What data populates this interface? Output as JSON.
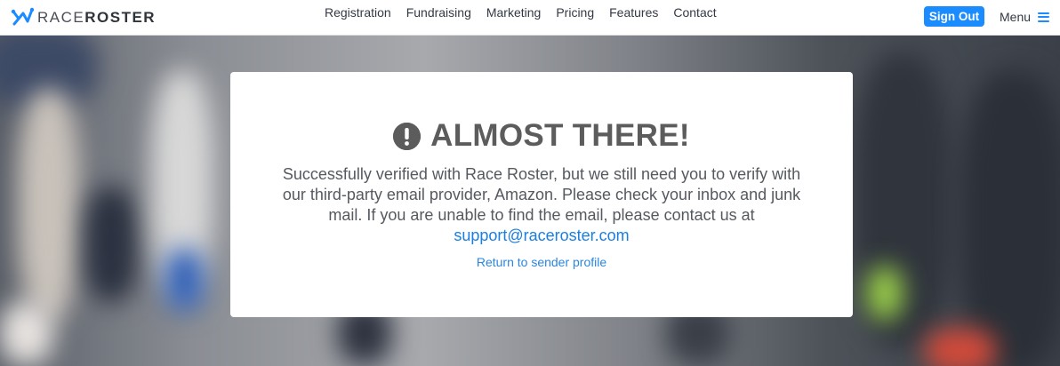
{
  "header": {
    "logo": {
      "word1": "RACE",
      "word2": "ROSTER"
    },
    "nav": [
      "Registration",
      "Fundraising",
      "Marketing",
      "Pricing",
      "Features",
      "Contact"
    ],
    "sign_out_label": "Sign Out",
    "menu_label": "Menu"
  },
  "card": {
    "title": "ALMOST THERE!",
    "message": "Successfully verified with Race Roster, but we still need you to verify with our third-party email provider, Amazon. Please check your inbox and junk mail. If you are unable to find the email, please contact us at",
    "support_email": "support@raceroster.com",
    "return_link": "Return to sender profile"
  },
  "colors": {
    "accent": "#1a8cff",
    "title": "#5c5c5c",
    "link": "#1a7fe0"
  }
}
